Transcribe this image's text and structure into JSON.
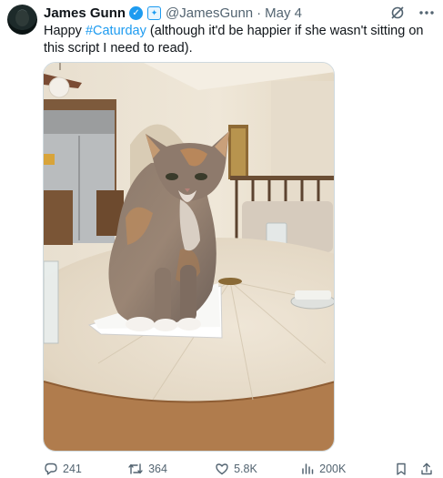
{
  "author": {
    "name": "James Gunn",
    "handle": "@JamesGunn",
    "separator": "·",
    "date": "May 4"
  },
  "tweet": {
    "text_before": "Happy ",
    "hashtag": "#Caturday",
    "text_after": " (although it'd be happier if she wasn't sitting on this script I need to read)."
  },
  "icons": {
    "verified": "verified-badge-icon",
    "affiliate": "affiliate-badge-icon",
    "grok": "grok-icon",
    "more": "more-icon",
    "reply": "reply-icon",
    "retweet": "retweet-icon",
    "like": "heart-icon",
    "views": "views-icon",
    "bookmark": "bookmark-icon",
    "share": "share-icon"
  },
  "colors": {
    "accent": "#1d9bf0",
    "secondary_text": "#536471"
  },
  "stats": {
    "replies": "241",
    "retweets": "364",
    "likes": "5.8K",
    "views": "200K"
  }
}
